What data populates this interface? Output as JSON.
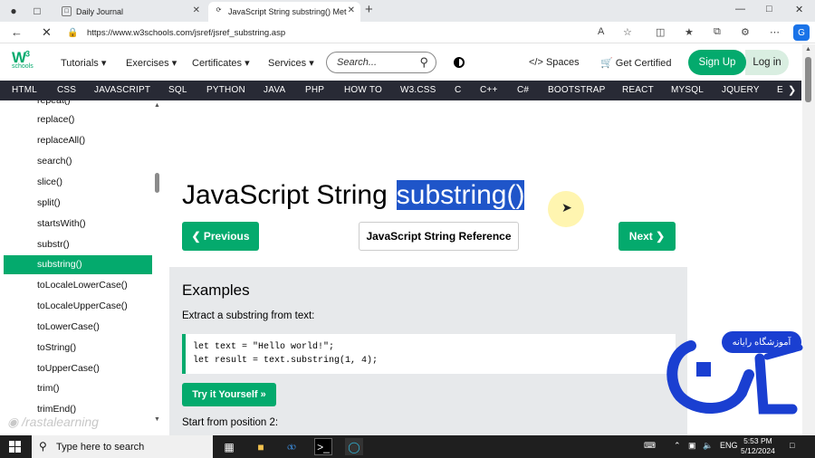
{
  "browser": {
    "tabs": [
      {
        "title": "Daily Journal"
      },
      {
        "title": "JavaScript String substring() Met"
      }
    ],
    "url": "https://www.w3schools.com/jsref/jsref_substring.asp",
    "profile_letter": "G"
  },
  "header": {
    "logo_main": "W",
    "logo_sup": "3",
    "logo_sub": "schools",
    "menus": [
      "Tutorials",
      "Exercises",
      "Certificates",
      "Services"
    ],
    "search_placeholder": "Search...",
    "spaces": "Spaces",
    "get_certified": "Get Certified",
    "sign_up": "Sign Up",
    "log_in": "Log in"
  },
  "topics": [
    "HTML",
    "CSS",
    "JAVASCRIPT",
    "SQL",
    "PYTHON",
    "JAVA",
    "PHP",
    "HOW TO",
    "W3.CSS",
    "C",
    "C++",
    "C#",
    "BOOTSTRAP",
    "REACT",
    "MYSQL",
    "JQUERY",
    "E"
  ],
  "sidebar": {
    "partial_top": "repeat()",
    "items": [
      "replace()",
      "replaceAll()",
      "search()",
      "slice()",
      "split()",
      "startsWith()",
      "substr()",
      "substring()",
      "toLocaleLowerCase()",
      "toLocaleUpperCase()",
      "toLowerCase()",
      "toString()",
      "toUpperCase()",
      "trim()",
      "trimEnd()"
    ],
    "active_index": 7
  },
  "main": {
    "title_prefix": "JavaScript String",
    "title_selected": "substring()",
    "prev": "Previous",
    "reference": "JavaScript String Reference",
    "next": "Next",
    "example_title": "Examples",
    "example_desc": "Extract a substring from text:",
    "code_line1": "let text = \"Hello world!\";",
    "code_line2": "let result = text.substring(1, 4);",
    "try_it": "Try it Yourself »",
    "start_from": "Start from position 2:"
  },
  "overlay": {
    "watermark": "/rastalearning",
    "brand_badge": "آموزشگاه رایانه"
  },
  "taskbar": {
    "search_placeholder": "Type here to search",
    "lang": "ENG",
    "time": "5:53 PM",
    "date": "5/12/2024"
  },
  "colors": {
    "accent": "#04aa6d",
    "topics_bg": "#282a35",
    "selection": "#1f55c9",
    "brand_blue": "#1a3fd1"
  }
}
